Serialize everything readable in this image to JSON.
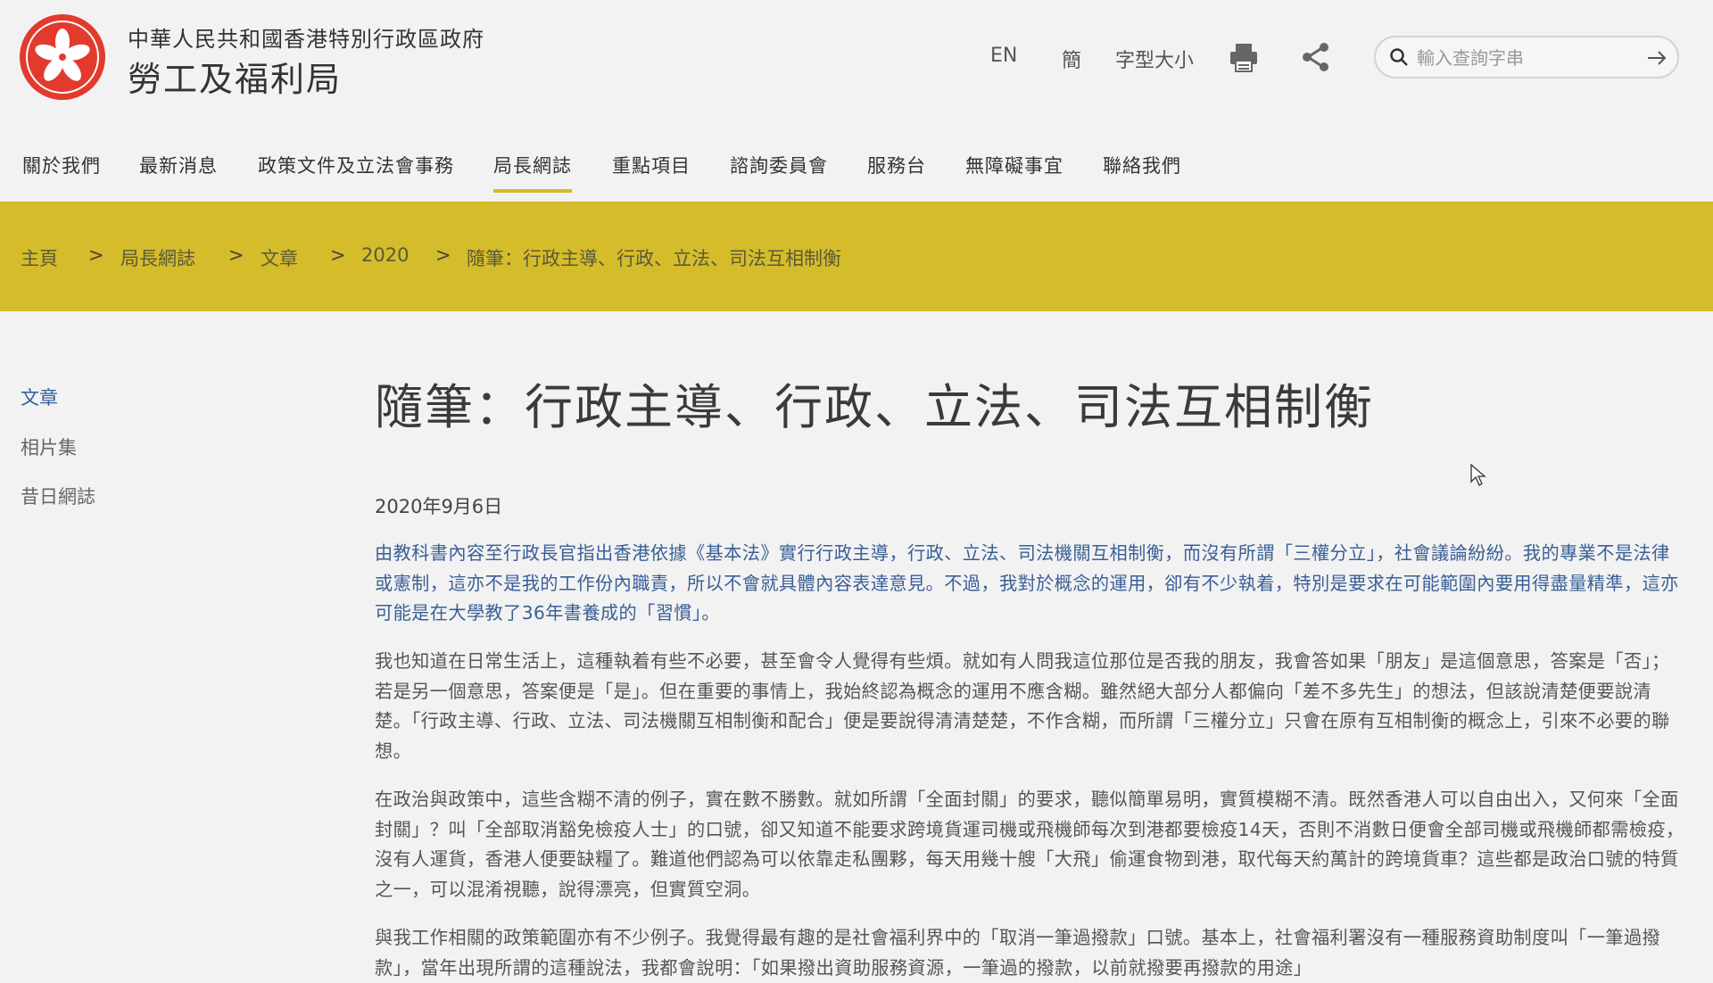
{
  "header": {
    "gov_name": "中華人民共和國香港特別行政區政府",
    "bureau_name": "勞工及福利局",
    "lang_en": "EN",
    "lang_sc": "簡",
    "font_size": "字型大小",
    "search_placeholder": "輸入查詢字串",
    "icons": {
      "emblem": "hksar-emblem-icon",
      "print": "print-icon",
      "share": "share-icon",
      "search": "search-icon",
      "submit": "arrow-right-icon"
    }
  },
  "nav": {
    "items": [
      "關於我們",
      "最新消息",
      "政策文件及立法會事務",
      "局長網誌",
      "重點項目",
      "諮詢委員會",
      "服務台",
      "無障礙事宜",
      "聯絡我們"
    ],
    "active_index": 3
  },
  "breadcrumb": {
    "items": [
      "主頁",
      "局長網誌",
      "文章",
      "2020",
      "隨筆：行政主導、行政、立法、司法互相制衡"
    ],
    "separator": ">"
  },
  "sidebar": {
    "items": [
      "文章",
      "相片集",
      "昔日網誌"
    ],
    "active_index": 0
  },
  "article": {
    "title": "隨筆：行政主導、行政、立法、司法互相制衡",
    "date": "2020年9月6日",
    "paragraphs": [
      "由教科書內容至行政長官指出香港依據《基本法》實行行政主導，行政、立法、司法機關互相制衡，而沒有所謂「三權分立」，社會議論紛紛。我的專業不是法律或憲制，這亦不是我的工作份內職責，所以不會就具體內容表達意見。不過，我對於概念的運用，卻有不少執着，特別是要求在可能範圍內要用得盡量精準，這亦可能是在大學教了36年書養成的「習慣」。",
      "我也知道在日常生活上，這種執着有些不必要，甚至會令人覺得有些煩。就如有人問我這位那位是否我的朋友，我會答如果「朋友」是這個意思，答案是「否」；若是另一個意思，答案便是「是」。但在重要的事情上，我始終認為概念的運用不應含糊。雖然絕大部分人都偏向「差不多先生」的想法，但該說清楚便要說清楚。「行政主導、行政、立法、司法機關互相制衡和配合」便是要說得清清楚楚，不作含糊，而所謂「三權分立」只會在原有互相制衡的概念上，引來不必要的聯想。",
      "在政治與政策中，這些含糊不清的例子，實在數不勝數。就如所謂「全面封關」的要求，聽似簡單易明，實質模糊不清。既然香港人可以自由出入，又何來「全面封關」？叫「全部取消豁免檢疫人士」的口號，卻又知道不能要求跨境貨運司機或飛機師每次到港都要檢疫14天，否則不消數日便會全部司機或飛機師都需檢疫，沒有人運貨，香港人便要缺糧了。難道他們認為可以依靠走私團夥，每天用幾十艘「大飛」偷運食物到港，取代每天約萬計的跨境貨車？這些都是政治口號的特質之一，可以混淆視聽，說得漂亮，但實質空洞。",
      "與我工作相關的政策範圍亦有不少例子。我覺得最有趣的是社會福利界中的「取消一筆過撥款」口號。基本上，社會福利署沒有一種服務資助制度叫「一筆過撥款」，當年出現所謂的這種說法，我都會說明：「如果撥出資助服務資源，一筆過的撥款，以前就撥要再撥款的用途」"
    ]
  }
}
